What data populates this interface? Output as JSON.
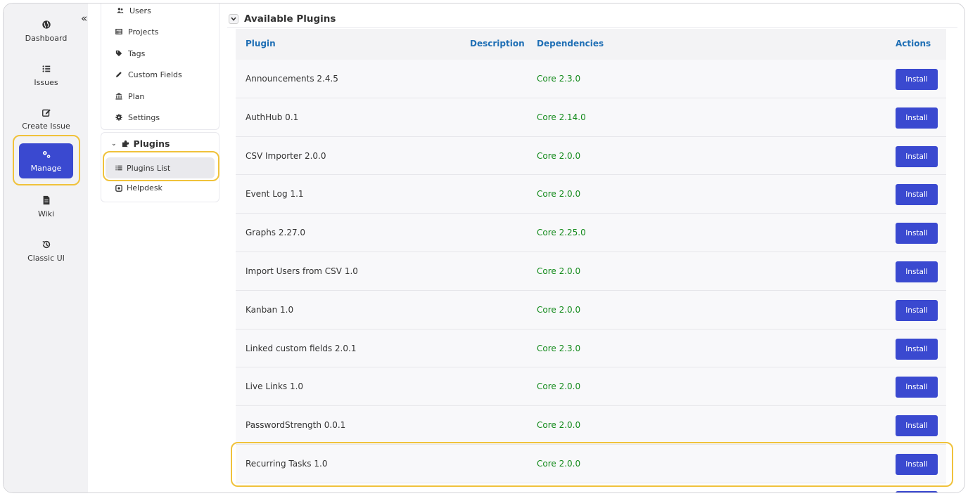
{
  "rail": {
    "collapse_icon": "chevron-double-left",
    "items": [
      {
        "label": "Dashboard",
        "icon": "globe-icon"
      },
      {
        "label": "Issues",
        "icon": "list-icon"
      },
      {
        "label": "Create Issue",
        "icon": "edit-icon"
      },
      {
        "label": "Manage",
        "icon": "gears-icon",
        "active": true
      },
      {
        "label": "Wiki",
        "icon": "document-icon"
      },
      {
        "label": "Classic UI",
        "icon": "history-icon"
      }
    ]
  },
  "subnav": {
    "items": [
      {
        "label": "Users",
        "icon": "users-icon"
      },
      {
        "label": "Projects",
        "icon": "table-icon"
      },
      {
        "label": "Tags",
        "icon": "tag-icon"
      },
      {
        "label": "Custom Fields",
        "icon": "pencil-icon"
      },
      {
        "label": "Plan",
        "icon": "bank-icon"
      },
      {
        "label": "Settings",
        "icon": "gear-icon"
      }
    ],
    "plugins_section": "Plugins",
    "plugins_list": "Plugins List",
    "helpdesk": "Helpdesk"
  },
  "main": {
    "section_title": "Available Plugins",
    "columns": {
      "plugin": "Plugin",
      "description": "Description",
      "dependencies": "Dependencies",
      "actions": "Actions"
    },
    "install_label": "Install",
    "rows": [
      {
        "name": "Announcements 2.4.5",
        "dep": "Core 2.3.0"
      },
      {
        "name": "AuthHub 0.1",
        "dep": "Core 2.14.0"
      },
      {
        "name": "CSV Importer 2.0.0",
        "dep": "Core 2.0.0"
      },
      {
        "name": "Event Log 1.1",
        "dep": "Core 2.0.0"
      },
      {
        "name": "Graphs 2.27.0",
        "dep": "Core 2.25.0"
      },
      {
        "name": "Import Users from CSV 1.0",
        "dep": "Core 2.0.0"
      },
      {
        "name": "Kanban 1.0",
        "dep": "Core 2.0.0"
      },
      {
        "name": "Linked custom fields 2.0.1",
        "dep": "Core 2.3.0"
      },
      {
        "name": "Live Links 1.0",
        "dep": "Core 2.0.0"
      },
      {
        "name": "PasswordStrength 0.0.1",
        "dep": "Core 2.0.0"
      },
      {
        "name": "Recurring Tasks 1.0",
        "dep": "Core 2.0.0"
      }
    ]
  },
  "colors": {
    "accent": "#3a49d0",
    "highlight": "#f0c23b",
    "header_link": "#1f6fb5",
    "dependency": "#138a1b"
  }
}
